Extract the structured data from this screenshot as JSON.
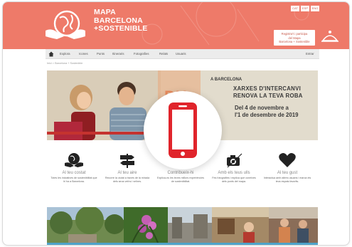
{
  "header": {
    "logo_lines": [
      "MAPA",
      "BARCELONA",
      "+SOSTENIBLE"
    ],
    "languages": [
      "CAT",
      "ESP",
      "ENG"
    ],
    "register_lines": [
      "Registra't i participa",
      "del Mapa",
      "Barcelona + Sostenible"
    ]
  },
  "nav": {
    "items": [
      "Explora",
      "Icones",
      "Punts",
      "Itineraris",
      "Fotografies",
      "Relats",
      "Usuaris"
    ],
    "right": "Entrar"
  },
  "breadcrumb": "Inici  >  Barcelona + Sostenible",
  "banner": {
    "top_text": "A BARCELONA",
    "line1": "XARXES D'INTERCANVI",
    "line2": "RENOVA LA TEVA ROBA",
    "line3": "Del 4 de novembre a",
    "line4": "l'1 de desembre de 2019"
  },
  "features": [
    {
      "icon": "globe-hands-icon",
      "title": "Al teu costat",
      "desc": "Totes les iniciatives de sostenibilitat que hi ha a Barcelona."
    },
    {
      "icon": "signpost-icon",
      "title": "Al teu aire",
      "desc": "Recorre la ciutat a través de la mirada dels seus veïns i veïnes."
    },
    {
      "icon": "pencil-icon",
      "title": "Contribueix-hi",
      "desc": "Explica-ns les teves millors experiències de sostenibilitat."
    },
    {
      "icon": "camera-icon",
      "title": "Amb els teus ulls",
      "desc": "Fes fotografies i explica què coneixes dels punts del mapa."
    },
    {
      "icon": "heart-icon",
      "title": "Al teu gust",
      "desc": "Interactua amb altres usuaris i marca els teus espais favorits."
    }
  ],
  "colors": {
    "header": "#ee7a69",
    "device_icon": "#e0242b"
  }
}
